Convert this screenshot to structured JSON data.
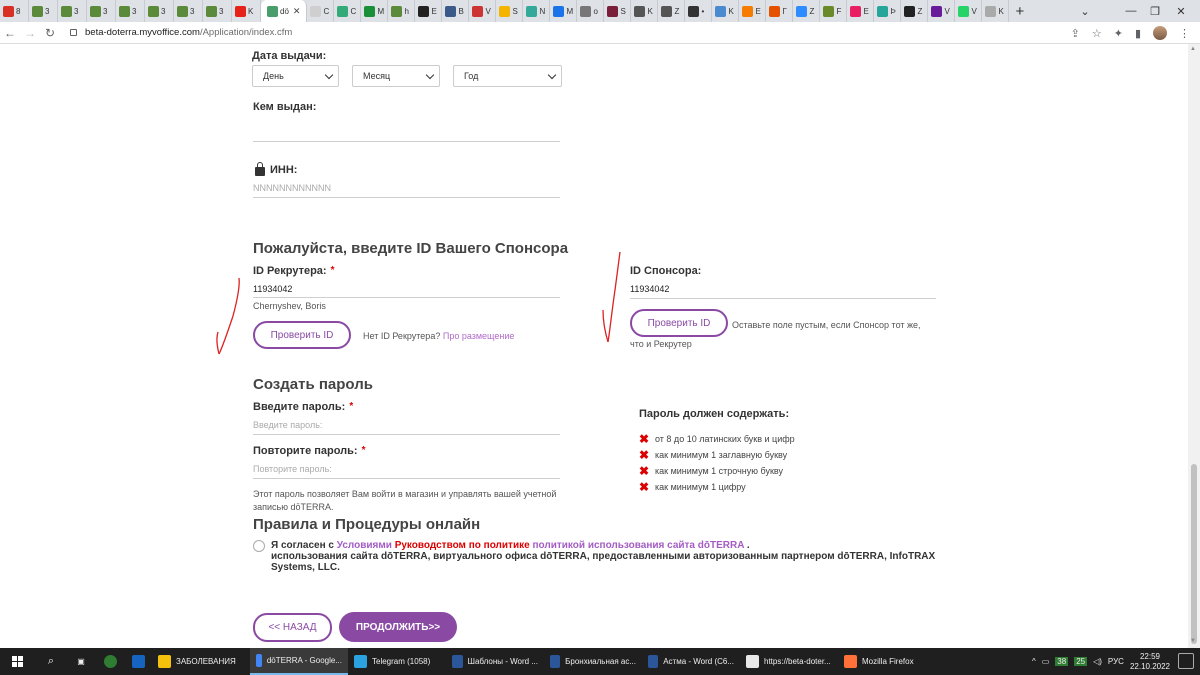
{
  "browser": {
    "active_tab_title": "dö",
    "url_host": "beta-doterra.myvoffice.com",
    "url_path": "/Application/index.cfm",
    "tabs": [
      {
        "label": "8",
        "color": "#d93025"
      },
      {
        "label": "3",
        "color": "#5a8a3a"
      },
      {
        "label": "3",
        "color": "#5a8a3a"
      },
      {
        "label": "3",
        "color": "#5a8a3a"
      },
      {
        "label": "3",
        "color": "#5a8a3a"
      },
      {
        "label": "3",
        "color": "#5a8a3a"
      },
      {
        "label": "3",
        "color": "#5a8a3a"
      },
      {
        "label": "3",
        "color": "#5a8a3a"
      },
      {
        "label": "K",
        "color": "#e62117"
      }
    ],
    "tabs_after": [
      {
        "label": "C",
        "color": "#cfcfcf"
      },
      {
        "label": "C",
        "color": "#3a7"
      },
      {
        "label": "M",
        "color": "#1a8f3a"
      },
      {
        "label": "h",
        "color": "#5a8a3a"
      },
      {
        "label": "E",
        "color": "#222"
      },
      {
        "label": "B",
        "color": "#3a5a8a"
      },
      {
        "label": "V",
        "color": "#c33"
      },
      {
        "label": "S",
        "color": "#f4b400"
      },
      {
        "label": "N",
        "color": "#3a9"
      },
      {
        "label": "M",
        "color": "#1a73e8"
      },
      {
        "label": "o",
        "color": "#777"
      },
      {
        "label": "S",
        "color": "#7a1f3a"
      },
      {
        "label": "K",
        "color": "#555"
      },
      {
        "label": "Z",
        "color": "#555"
      },
      {
        "label": "•",
        "color": "#333"
      },
      {
        "label": "K",
        "color": "#4a8ad0"
      },
      {
        "label": "E",
        "color": "#f57c00"
      },
      {
        "label": "Г",
        "color": "#e65100"
      },
      {
        "label": "Z",
        "color": "#2d8cff"
      },
      {
        "label": "F",
        "color": "#6a8a2a"
      },
      {
        "label": "E",
        "color": "#e91e63"
      },
      {
        "label": "Þ",
        "color": "#26a69a"
      },
      {
        "label": "Z",
        "color": "#222"
      },
      {
        "label": "V",
        "color": "#6a1b9a"
      },
      {
        "label": "V",
        "color": "#25d366"
      },
      {
        "label": "K",
        "color": "#aaa"
      }
    ]
  },
  "form": {
    "issue_date_label": "Дата выдачи:",
    "day_select": "День",
    "month_select": "Месяц",
    "year_select": "Год",
    "issued_by_label": "Кем выдан:",
    "inn_label": "ИНН:",
    "inn_placeholder": "NNNNNNNNNNNN",
    "sponsor_heading": "Пожалуйста, введите ID Вашего Спонсора",
    "recruiter_label": "ID Рекрутера:",
    "recruiter_value": "11934042",
    "recruiter_name": "Chernyshev, Boris",
    "check_id_button": "Проверить ID",
    "no_recruiter_text": "Нет ID Рекрутера?",
    "placement_link": "Про размещение",
    "sponsor_label": "ID Спонсора:",
    "sponsor_value": "11934042",
    "sponsor_check_button": "Проверить ID",
    "sponsor_hint_1": "Оставьте поле пустым, если Спонсор тот же,",
    "sponsor_hint_2": "что и Рекрутер",
    "password_heading": "Создать пароль",
    "password_label": "Введите пароль:",
    "password_placeholder": "Введите пароль:",
    "repeat_label": "Повторите пароль:",
    "repeat_placeholder": "Повторите пароль:",
    "password_note_1": "Этот пароль позволяет Вам войти в магазин и управлять вашей учетной",
    "password_note_2": "записью dōTERRA.",
    "requirements_title": "Пароль должен содержать:",
    "requirements": [
      "от 8 до 10 латинских букв и цифр",
      "как минимум 1 заглавную букву",
      "как минимум 1 строчную букву",
      "как минимум 1 цифру"
    ],
    "rules_heading": "Правила и Процедуры онлайн",
    "terms_prefix": "Я согласен с",
    "terms_link1": "Условиями",
    "terms_link2": "Руководством по политике",
    "terms_link3": "политикой использования сайта dōTERRA",
    "terms_line2": "использования сайта dōTERRA, виртуального офиса dōTERRA, предоставленными авторизованным партнером dōTERRA, InfoTRAX",
    "terms_line3": "Systems, LLC.",
    "back_button": "<< НАЗАД",
    "continue_button": "ПРОДОЛЖИТЬ>>"
  },
  "taskbar": {
    "items": [
      {
        "label": "ЗАБОЛЕВАНИЯ",
        "color": "#f4c20d"
      },
      {
        "label": "dōTERRA - Google...",
        "color": "#4285f4",
        "active": true
      },
      {
        "label": "Telegram (1058)",
        "color": "#2aa3e0"
      },
      {
        "label": "Шаблоны - Word ...",
        "color": "#2b579a"
      },
      {
        "label": "Бронхиальная ас...",
        "color": "#2b579a"
      },
      {
        "label": "Астма - Word (C6...",
        "color": "#2b579a"
      },
      {
        "label": "https://beta-doter...",
        "color": "#e8e8e8"
      },
      {
        "label": "Mozilla Firefox",
        "color": "#ff7139"
      }
    ],
    "lang": "РУС",
    "time": "22:59",
    "date": "22.10.2022"
  }
}
